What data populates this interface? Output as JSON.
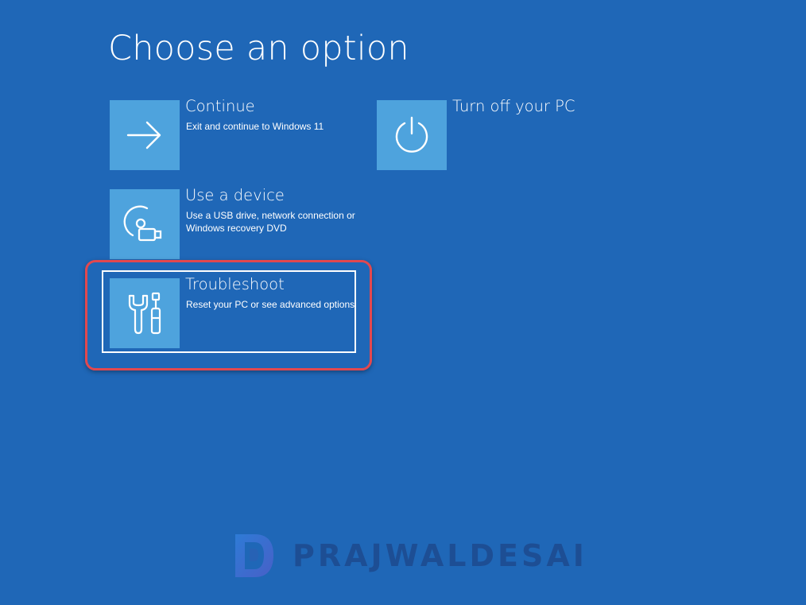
{
  "page": {
    "title": "Choose an option",
    "background_color": "#1f67b7",
    "tile_color": "#4ea3dd"
  },
  "options": [
    {
      "id": "continue",
      "title": "Continue",
      "description": "Exit and continue to Windows 11",
      "icon": "arrow-right-icon"
    },
    {
      "id": "use-device",
      "title": "Use a device",
      "description": "Use a USB drive, network connection or Windows recovery DVD",
      "icon": "disc-usb-icon"
    },
    {
      "id": "troubleshoot",
      "title": "Troubleshoot",
      "description": "Reset your PC or see advanced options",
      "icon": "tools-icon",
      "selected": true,
      "highlighted": true
    },
    {
      "id": "turn-off",
      "title": "Turn off your PC",
      "description": "",
      "icon": "power-icon"
    }
  ],
  "highlight_color": "#e2484f",
  "watermark": {
    "text": "PRAJWALDESAI",
    "logo": "pd-logo"
  }
}
